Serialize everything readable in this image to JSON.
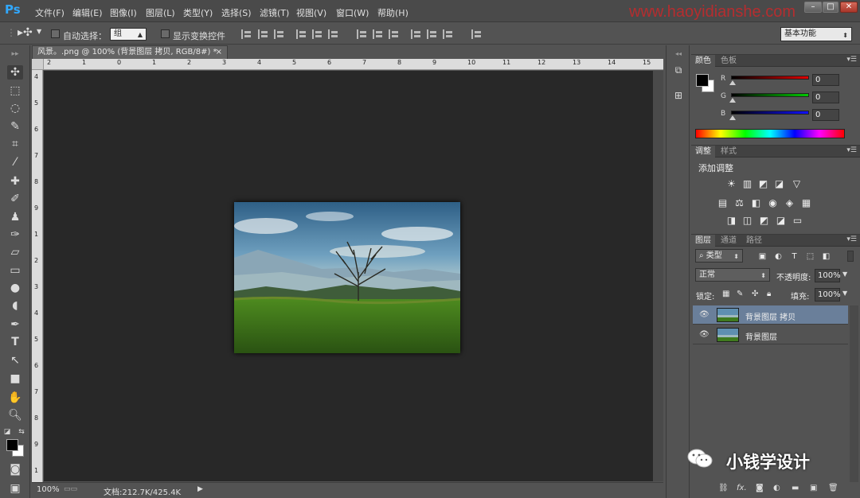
{
  "app": {
    "logo": "Ps"
  },
  "menu": [
    "文件(F)",
    "编辑(E)",
    "图像(I)",
    "图层(L)",
    "类型(Y)",
    "选择(S)",
    "滤镜(T)",
    "视图(V)",
    "窗口(W)",
    "帮助(H)"
  ],
  "watermark": "www.haoyidianshe.com",
  "window_controls": {
    "minimize": "–",
    "maximize": "□",
    "close": "✕"
  },
  "options": {
    "auto_select_label": "自动选择：",
    "auto_select_value": "组",
    "show_transform_label": "显示变换控件",
    "workspace": "基本功能"
  },
  "document": {
    "tab_title": "风景。.png @ 100% (背景图层 拷贝, RGB/8#) *",
    "tab_close": "×",
    "zoom": "100%",
    "doc_info": "文档:212.7K/425.4K"
  },
  "ruler": {
    "top": [
      "2",
      "1",
      "0",
      "1",
      "2",
      "3",
      "4",
      "5",
      "6",
      "7",
      "8",
      "9",
      "10",
      "11",
      "12",
      "13",
      "14",
      "15"
    ],
    "left": [
      "4",
      "5",
      "6",
      "7",
      "8",
      "9",
      "1",
      "2",
      "3",
      "4",
      "5",
      "6",
      "7",
      "8",
      "9",
      "1"
    ]
  },
  "color_panel": {
    "tabs": [
      "颜色",
      "色板"
    ],
    "channels": [
      {
        "label": "R",
        "value": "0"
      },
      {
        "label": "G",
        "value": "0"
      },
      {
        "label": "B",
        "value": "0"
      }
    ],
    "foreground": "#000000",
    "background": "#ffffff"
  },
  "adjust_panel": {
    "tabs": [
      "调整",
      "样式"
    ],
    "title": "添加调整",
    "icons_row1": [
      "☀",
      "▥",
      "◩",
      "◪",
      "▽"
    ],
    "icons_row2": [
      "▤",
      "⚖",
      "◧",
      "◉",
      "◈",
      "▦"
    ],
    "icons_row3": [
      "◨",
      "◫",
      "◩",
      "◪",
      "▭"
    ]
  },
  "layers_panel": {
    "tabs": [
      "图层",
      "通道",
      "路径"
    ],
    "filter_label": "类型",
    "blend_mode": "正常",
    "opacity_label": "不透明度:",
    "opacity": "100%",
    "lock_label": "锁定:",
    "fill_label": "填充:",
    "fill": "100%",
    "layers": [
      {
        "name": "背景图层 拷贝",
        "selected": true
      },
      {
        "name": "背景图层",
        "selected": false
      }
    ]
  },
  "brand": {
    "wechat_name": "小钱学设计"
  },
  "colors": {
    "accent": "#31a8ff",
    "selected_layer": "#6a7f9a"
  }
}
